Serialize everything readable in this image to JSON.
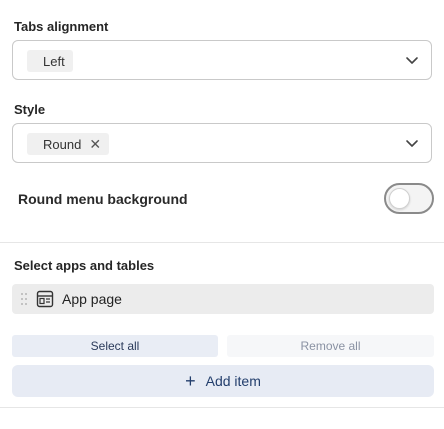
{
  "tabs_alignment": {
    "label": "Tabs alignment",
    "selected": "Left"
  },
  "style": {
    "label": "Style",
    "selected": "Round",
    "remove_glyph": "✕"
  },
  "round_menu_background": {
    "label": "Round menu background",
    "enabled": false
  },
  "apps_and_tables": {
    "label": "Select apps and tables",
    "items": [
      {
        "label": "App page",
        "icon": "app-page-icon"
      }
    ],
    "select_all_label": "Select all",
    "remove_all_label": "Remove all",
    "add_item_label": "Add item",
    "add_icon": "+"
  },
  "colors": {
    "accent": "#233e6c",
    "chip_bg": "#f0f0f0",
    "item_bg": "#ececec",
    "button_bg": "#e7ebf4"
  }
}
